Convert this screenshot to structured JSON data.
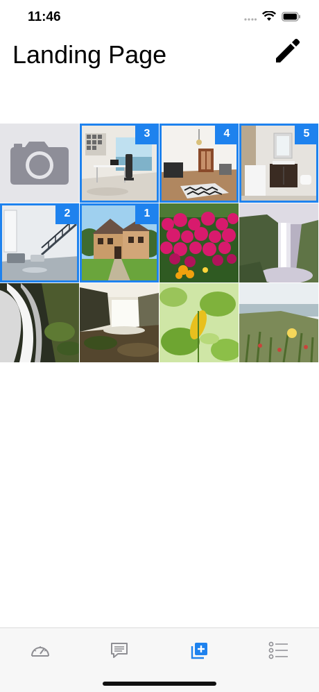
{
  "status": {
    "time": "11:46"
  },
  "nav": {
    "title": "Landing Page",
    "edit_icon": "pencil-icon"
  },
  "grid": {
    "cells": [
      {
        "kind": "camera",
        "icon": "camera-icon"
      },
      {
        "kind": "photo",
        "subject": "office-workspace",
        "selected": true,
        "badge": "3"
      },
      {
        "kind": "photo",
        "subject": "living-room",
        "selected": true,
        "badge": "4"
      },
      {
        "kind": "photo",
        "subject": "bathroom",
        "selected": true,
        "badge": "5"
      },
      {
        "kind": "photo",
        "subject": "modern-interior",
        "selected": true,
        "badge": "2"
      },
      {
        "kind": "photo",
        "subject": "house-exterior",
        "selected": true,
        "badge": "1"
      },
      {
        "kind": "photo",
        "subject": "pink-flowers",
        "selected": false
      },
      {
        "kind": "photo",
        "subject": "waterfall-cliff",
        "selected": false
      },
      {
        "kind": "photo",
        "subject": "waterfall-moss",
        "selected": false
      },
      {
        "kind": "photo",
        "subject": "waterfall-rocks",
        "selected": false
      },
      {
        "kind": "photo",
        "subject": "green-leaves",
        "selected": false
      },
      {
        "kind": "photo",
        "subject": "coastal-plants",
        "selected": false
      }
    ]
  },
  "tabs": [
    {
      "name": "dashboard",
      "icon": "speedometer-icon",
      "active": false
    },
    {
      "name": "messages",
      "icon": "message-icon",
      "active": false
    },
    {
      "name": "add",
      "icon": "add-square-icon",
      "active": true
    },
    {
      "name": "list",
      "icon": "list-icon",
      "active": false
    }
  ],
  "colors": {
    "accent": "#1e82ee",
    "badge_text": "#ffffff",
    "inactive_tab": "#8e8e93"
  }
}
